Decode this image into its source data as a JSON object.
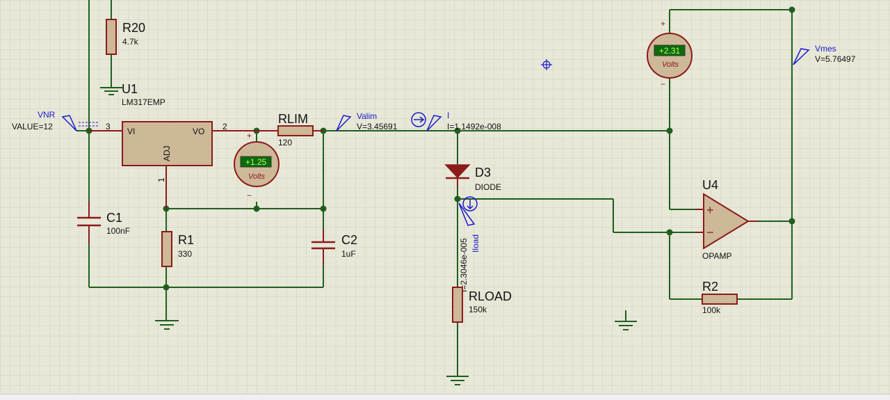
{
  "colors": {
    "background": "#e8e8d8",
    "grid": "#cfcfbf",
    "wire": "#1f5e1f",
    "component": "#8b1a1a",
    "component_fill": "#cdb898",
    "probe": "#1a1acc",
    "text": "#111111",
    "meter_display": "#0b6b0b",
    "meter_digits": "#b8ff66"
  },
  "components": {
    "r20": {
      "ref": "R20",
      "value": "4.7k"
    },
    "u1": {
      "ref": "U1",
      "part": "LM317EMP",
      "pin_vi": "VI",
      "pin_vo": "VO",
      "pin_adj": "ADJ",
      "pin3": "3",
      "pin2": "2",
      "pin1": "1"
    },
    "vnr": {
      "ref": "VNR",
      "value": "VALUE=12"
    },
    "rlim": {
      "ref": "RLIM",
      "value": "120"
    },
    "c1": {
      "ref": "C1",
      "value": "100nF"
    },
    "r1": {
      "ref": "R1",
      "value": "330"
    },
    "c2": {
      "ref": "C2",
      "value": "1uF"
    },
    "d3": {
      "ref": "D3",
      "value": "DIODE"
    },
    "rload": {
      "ref": "RLOAD",
      "value": "150k"
    },
    "u4": {
      "ref": "U4",
      "part": "OPAMP",
      "plus": "+",
      "minus": "−"
    },
    "r2": {
      "ref": "R2",
      "value": "100k"
    }
  },
  "probes": {
    "valim": {
      "name": "Valim",
      "reading": "V=3.45691"
    },
    "i": {
      "name": "I",
      "reading": "I=1.1492e-008"
    },
    "iload": {
      "name": "Iload",
      "reading": "I=2.3046e-005"
    },
    "vmes": {
      "name": "Vmes",
      "reading": "V=5.76497"
    }
  },
  "meters": {
    "vm1": {
      "reading": "+1.25",
      "unit": "Volts",
      "plus": "+",
      "minus": "−"
    },
    "vm2": {
      "reading": "+2.31",
      "unit": "Volts",
      "plus": "+",
      "minus": "−"
    }
  }
}
